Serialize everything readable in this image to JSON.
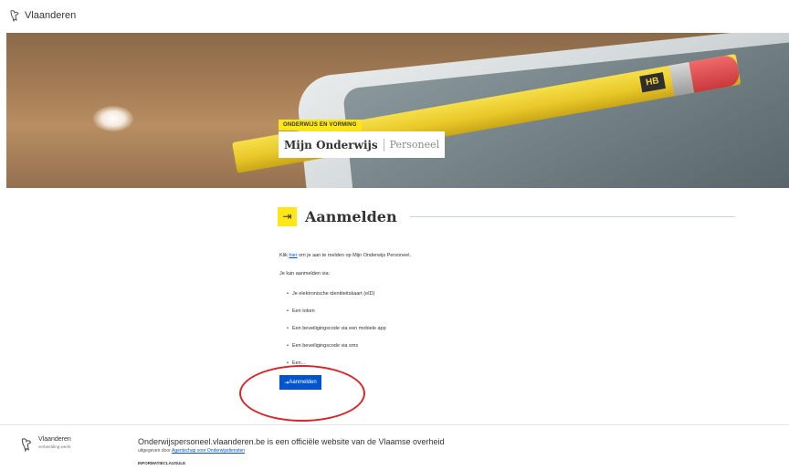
{
  "header": {
    "brand": "Vlaanderen"
  },
  "hero": {
    "badge": "ONDERWIJS EN VORMING",
    "title_main": "Mijn Onderwijs",
    "title_sub": "Personeel",
    "pencil_label": "HB"
  },
  "login": {
    "heading": "Aanmelden",
    "intro_prefix": "Klik ",
    "intro_link": "hier",
    "intro_suffix": " om je aan te melden op Mijn Onderwijs Personeel.",
    "methods_label": "Je kan aanmelden via:",
    "methods": [
      "Je elektronische identiteitskaart (eID)",
      "Een token",
      "Een beveiligingscode via een mobiele app",
      "Een beveiligingscode via sms",
      "Een..."
    ],
    "button_label": "Aanmelden",
    "button_icon": "login-icon",
    "accent_color": "#ffe615",
    "button_color": "#0055cc",
    "highlight_color": "#d9262c"
  },
  "footer": {
    "brand": "Vlaanderen",
    "tagline": "verbeelding werkt",
    "title": "Onderwijspersoneel.vlaanderen.be is een officiële website van de Vlaamse overheid",
    "publisher_prefix": "uitgegeven door ",
    "publisher_link": "Agentschap voor Onderwijsdiensten",
    "info_label": "INFORMATIECLAUSULE"
  }
}
